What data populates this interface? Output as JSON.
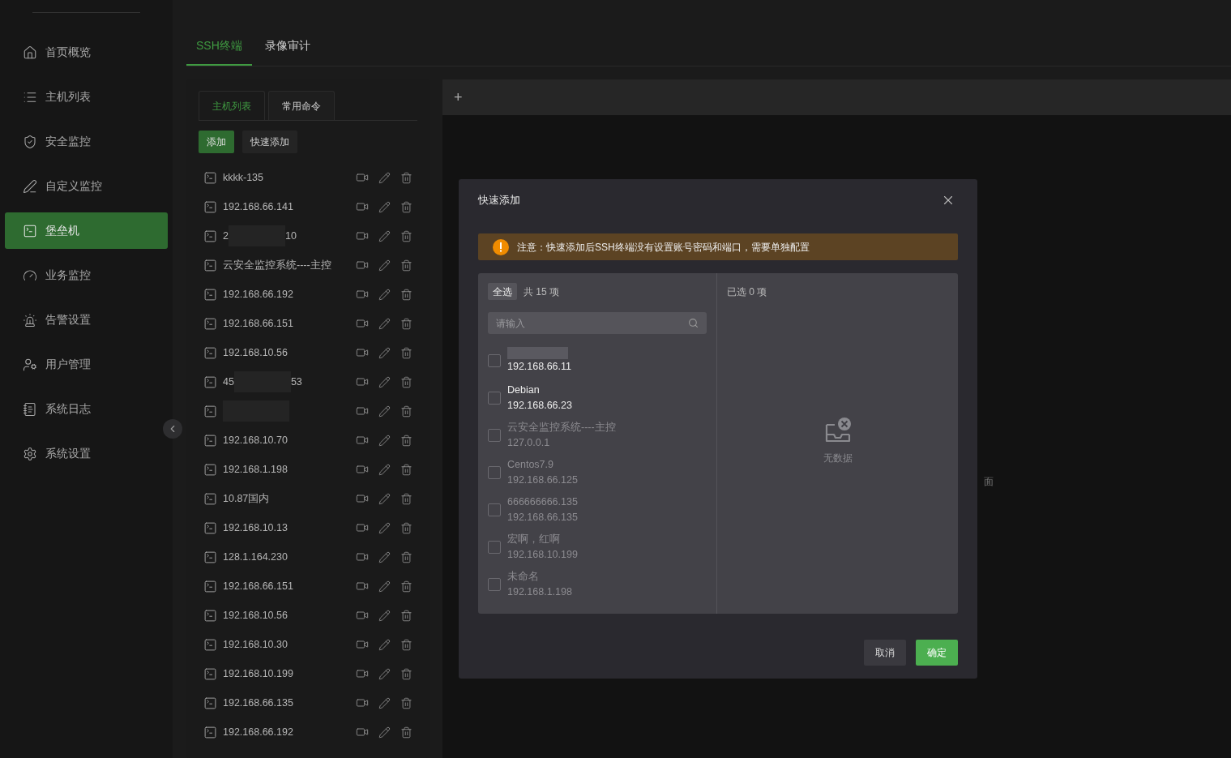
{
  "sidebar": {
    "items": [
      {
        "label": "首页概览",
        "selected": false
      },
      {
        "label": "主机列表",
        "selected": false
      },
      {
        "label": "安全监控",
        "selected": false
      },
      {
        "label": "自定义监控",
        "selected": false
      },
      {
        "label": "堡垒机",
        "selected": true
      },
      {
        "label": "业务监控",
        "selected": false
      },
      {
        "label": "告警设置",
        "selected": false
      },
      {
        "label": "用户管理",
        "selected": false
      },
      {
        "label": "系统日志",
        "selected": false
      },
      {
        "label": "系统设置",
        "selected": false
      }
    ]
  },
  "tabs": [
    {
      "label": "SSH终端",
      "selected": true
    },
    {
      "label": "录像审计",
      "selected": false
    }
  ],
  "host_panel": {
    "tabs": [
      {
        "label": "主机列表",
        "selected": true
      },
      {
        "label": "常用命令",
        "selected": false
      }
    ],
    "buttons": [
      {
        "label": "添加",
        "kind": "primary"
      },
      {
        "label": "快速添加",
        "kind": "default"
      }
    ],
    "hosts": [
      {
        "name": "kkkk-135"
      },
      {
        "name": "192.168.66.141"
      },
      {
        "name": "2",
        "name_tail": "10",
        "redacted": true
      },
      {
        "name": "云安全监控系统----主控"
      },
      {
        "name": "192.168.66.192"
      },
      {
        "name": "192.168.66.151"
      },
      {
        "name": "192.168.10.56"
      },
      {
        "name": "45",
        "name_tail": "53",
        "redacted": true
      },
      {
        "redacted": true
      },
      {
        "name": "192.168.10.70"
      },
      {
        "name": "192.168.1.198"
      },
      {
        "name": "10.87国内"
      },
      {
        "name": "192.168.10.13"
      },
      {
        "name": "128.1.164.230"
      },
      {
        "name": "192.168.66.151"
      },
      {
        "name": "192.168.10.56"
      },
      {
        "name": "192.168.10.30"
      },
      {
        "name": "192.168.10.199"
      },
      {
        "name": "192.168.66.135"
      },
      {
        "name": "192.168.66.192"
      }
    ]
  },
  "terminal": {
    "add_tab": "+",
    "background_text": "面"
  },
  "dialog": {
    "title": "快速添加",
    "notice": "注意：快速添加后SSH终端没有设置账号密码和端口，需要单独配置",
    "source": {
      "select_all": "全选",
      "count": "共 15 项",
      "search_placeholder": "请输入",
      "items": [
        {
          "ip": "192.168.66.11",
          "redacted": true,
          "checked": false,
          "disabled": false
        },
        {
          "name": "Debian",
          "ip": "192.168.66.23",
          "checked": false,
          "disabled": false
        },
        {
          "name": "云安全监控系统----主控",
          "ip": "127.0.0.1",
          "checked": false,
          "disabled": true
        },
        {
          "name": "Centos7.9",
          "ip": "192.168.66.125",
          "checked": false,
          "disabled": true
        },
        {
          "name": "666666666.135",
          "ip": "192.168.66.135",
          "checked": false,
          "disabled": true
        },
        {
          "name": "宏啊，红啊",
          "ip": "192.168.10.199",
          "checked": false,
          "disabled": true
        },
        {
          "name": "未命名",
          "ip": "192.168.1.198",
          "checked": false,
          "disabled": true
        }
      ]
    },
    "target": {
      "count": "已选 0 项",
      "empty_text": "无数据"
    },
    "buttons": [
      {
        "label": "取消",
        "kind": "default"
      },
      {
        "label": "确定",
        "kind": "primary"
      }
    ]
  }
}
